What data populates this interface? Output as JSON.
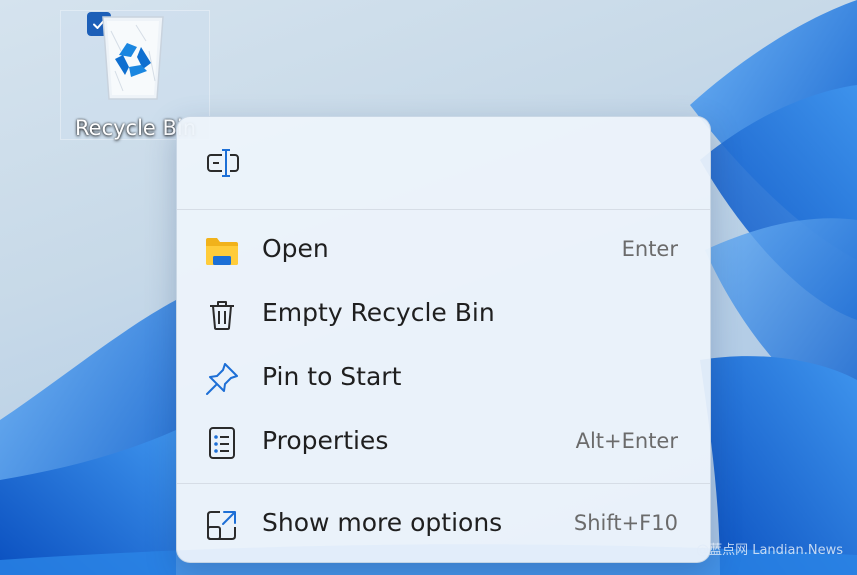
{
  "desktop": {
    "recycle_bin": {
      "label": "Recycle Bin",
      "icon": "recycle-bin-icon",
      "selected": true
    }
  },
  "context_menu": {
    "top_actions": [
      {
        "icon": "rename-icon"
      }
    ],
    "items": [
      {
        "label": "Open",
        "shortcut": "Enter",
        "icon": "folder-icon"
      },
      {
        "label": "Empty Recycle Bin",
        "shortcut": "",
        "icon": "trash-icon"
      },
      {
        "label": "Pin to Start",
        "shortcut": "",
        "icon": "pin-icon"
      },
      {
        "label": "Properties",
        "shortcut": "Alt+Enter",
        "icon": "properties-icon"
      }
    ],
    "footer_item": {
      "label": "Show more options",
      "shortcut": "Shift+F10",
      "icon": "expand-icon"
    }
  },
  "watermark": {
    "text": "@蓝点网 Landian.News"
  },
  "colors": {
    "accent": "#1d5fb8",
    "menu_background": "#eef4fb",
    "wallpaper_blue": "#1e73d8"
  }
}
